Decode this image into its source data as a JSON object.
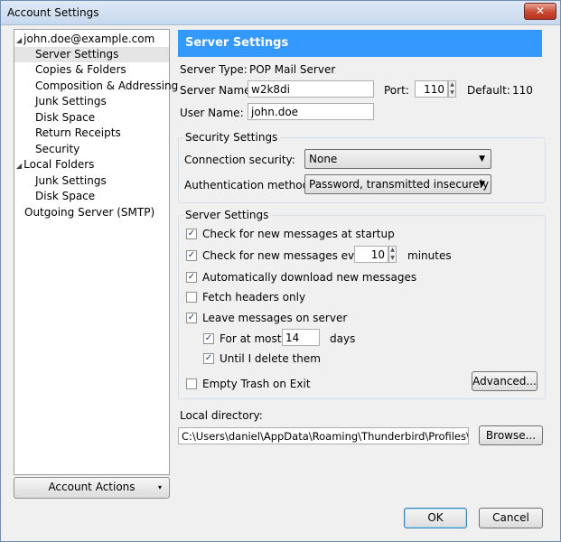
{
  "window": {
    "title": "Account Settings",
    "close_glyph": "✕"
  },
  "tree": {
    "expander_glyph": "◢",
    "account": "john.doe@example.com",
    "account_items": [
      "Server Settings",
      "Copies & Folders",
      "Composition & Addressing",
      "Junk Settings",
      "Disk Space",
      "Return Receipts",
      "Security"
    ],
    "local_folders": "Local Folders",
    "local_items": [
      "Junk Settings",
      "Disk Space"
    ],
    "outgoing": "Outgoing Server (SMTP)",
    "selected": "Server Settings"
  },
  "account_actions": {
    "label": "Account Actions",
    "arrow": "▾"
  },
  "header": {
    "title": "Server Settings",
    "color": "#3399ff"
  },
  "server": {
    "type_label": "Server Type:",
    "type_value": "POP Mail Server",
    "name_label": "Server Name:",
    "name_value": "w2k8di",
    "port_label": "Port:",
    "port_value": "110",
    "default_label": "Default:",
    "default_value": "110",
    "user_label": "User Name:",
    "user_value": "john.doe"
  },
  "security": {
    "group_title": "Security Settings",
    "connection_label": "Connection security:",
    "connection_value": "None",
    "auth_label": "Authentication method:",
    "auth_value": "Password, transmitted insecurely"
  },
  "settings": {
    "group_title": "Server Settings",
    "check_startup": "Check for new messages at startup",
    "check_every": "Check for new messages every",
    "check_every_value": "10",
    "minutes": "minutes",
    "auto_download": "Automatically download new messages",
    "fetch_headers": "Fetch headers only",
    "leave_on_server": "Leave messages on server",
    "for_at_most": "For at most",
    "for_at_most_value": "14",
    "days": "days",
    "until_delete": "Until I delete them",
    "empty_trash": "Empty Trash on Exit",
    "advanced_button": "Advanced..."
  },
  "checkbox_states": {
    "check_startup": true,
    "check_every": true,
    "auto_download": true,
    "fetch_headers": false,
    "leave_on_server": true,
    "for_at_most": true,
    "until_delete": true,
    "empty_trash": false
  },
  "check_glyph": "✓",
  "spinner": {
    "up": "▲",
    "down": "▼"
  },
  "combo_arrow": "▼",
  "local_dir": {
    "label": "Local directory:",
    "path": "C:\\Users\\daniel\\AppData\\Roaming\\Thunderbird\\Profiles\\opu",
    "browse_button": "Browse..."
  },
  "footer": {
    "ok": "OK",
    "cancel": "Cancel"
  }
}
